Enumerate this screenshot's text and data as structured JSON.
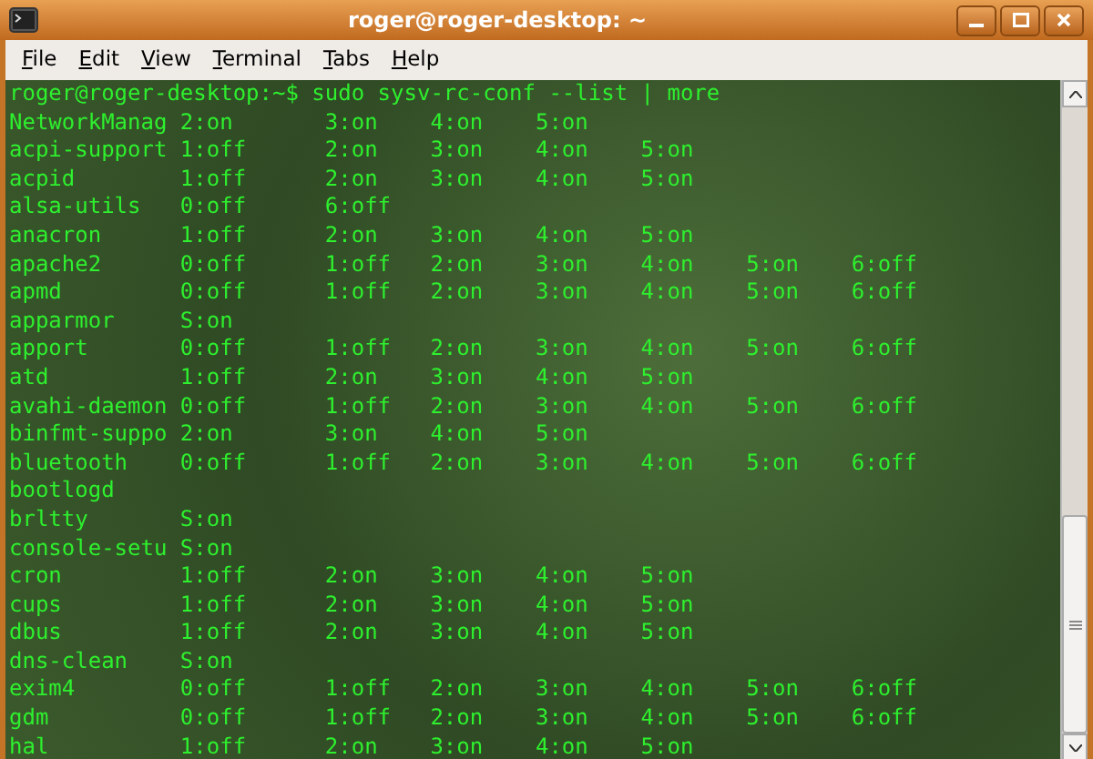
{
  "window": {
    "title": "roger@roger-desktop: ~"
  },
  "menu": [
    "File",
    "Edit",
    "View",
    "Terminal",
    "Tabs",
    "Help"
  ],
  "terminal": {
    "lines": [
      "roger@roger-desktop:~$ sudo sysv-rc-conf --list | more",
      "NetworkManag 2:on       3:on    4:on    5:on",
      "acpi-support 1:off      2:on    3:on    4:on    5:on",
      "acpid        1:off      2:on    3:on    4:on    5:on",
      "alsa-utils   0:off      6:off",
      "anacron      1:off      2:on    3:on    4:on    5:on",
      "apache2      0:off      1:off   2:on    3:on    4:on    5:on    6:off",
      "apmd         0:off      1:off   2:on    3:on    4:on    5:on    6:off",
      "apparmor     S:on",
      "apport       0:off      1:off   2:on    3:on    4:on    5:on    6:off",
      "atd          1:off      2:on    3:on    4:on    5:on",
      "avahi-daemon 0:off      1:off   2:on    3:on    4:on    5:on    6:off",
      "binfmt-suppo 2:on       3:on    4:on    5:on",
      "bluetooth    0:off      1:off   2:on    3:on    4:on    5:on    6:off",
      "bootlogd",
      "brltty       S:on",
      "console-setu S:on",
      "cron         1:off      2:on    3:on    4:on    5:on",
      "cups         1:off      2:on    3:on    4:on    5:on",
      "dbus         1:off      2:on    3:on    4:on    5:on",
      "dns-clean    S:on",
      "exim4        0:off      1:off   2:on    3:on    4:on    5:on    6:off",
      "gdm          0:off      1:off   2:on    3:on    4:on    5:on    6:off",
      "hal          1:off      2:on    3:on    4:on    5:on"
    ]
  }
}
